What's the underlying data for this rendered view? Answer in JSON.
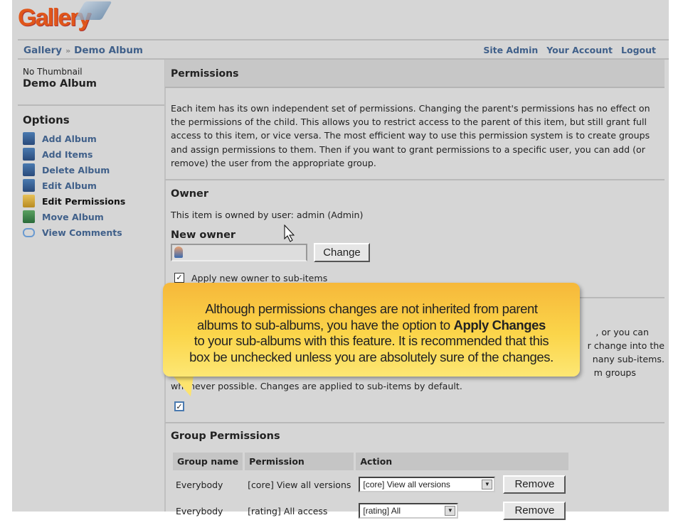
{
  "logo": "Gallery",
  "breadcrumb": [
    "Gallery",
    "Demo Album"
  ],
  "top_links": [
    "Site Admin",
    "Your Account",
    "Logout"
  ],
  "sidebar": {
    "thumbnail": "No Thumbnail",
    "album": "Demo Album",
    "options_title": "Options",
    "items": [
      {
        "label": "Add Album"
      },
      {
        "label": "Add Items"
      },
      {
        "label": "Delete Album"
      },
      {
        "label": "Edit Album"
      },
      {
        "label": "Edit Permissions"
      },
      {
        "label": "Move Album"
      },
      {
        "label": "View Comments"
      }
    ]
  },
  "main": {
    "title": "Permissions",
    "intro": "Each item has its own independent set of permissions. Changing the parent's permissions has no effect on the permissions of the child. This allows you to restrict access to the parent of this item, but still grant full access to this item, or vice versa. The most efficient way to use this permission system is to create groups and assign permissions to them. Then if you want to grant permissions to a specific user, you can add (or remove) the user from the appropriate group.",
    "owner_title": "Owner",
    "owner_text": "This item is owned by user: admin (Admin)",
    "new_owner_label": "New owner",
    "new_owner_value": "",
    "change_label": "Change",
    "apply_owner_label": "Apply new owner to sub-items",
    "hidden_fragments": [
      ", or you can",
      "r change into the",
      "nany sub-items.",
      "m groups"
    ],
    "apply_changes_text": "whenever possible. Changes are applied to sub-items by default.",
    "group_title": "Group Permissions",
    "table": {
      "headers": [
        "Group name",
        "Permission",
        "Action"
      ],
      "rows": [
        {
          "group": "Everybody",
          "permission": "[core] View all versions",
          "select": "[core] View all versions",
          "button": "Remove"
        },
        {
          "group": "Everybody",
          "permission": "[rating] All access",
          "select": "[rating] All",
          "button": "Remove"
        }
      ]
    }
  },
  "callout": {
    "line1": "Although permissions changes are not inherited from parent",
    "line2a": "albums to sub-albums, you have the option to ",
    "line2b": "Apply Changes",
    "line3": "to your sub-albums with this feature.  It is recommended that this",
    "line4": "box be unchecked unless you are absolutely sure of the changes."
  }
}
